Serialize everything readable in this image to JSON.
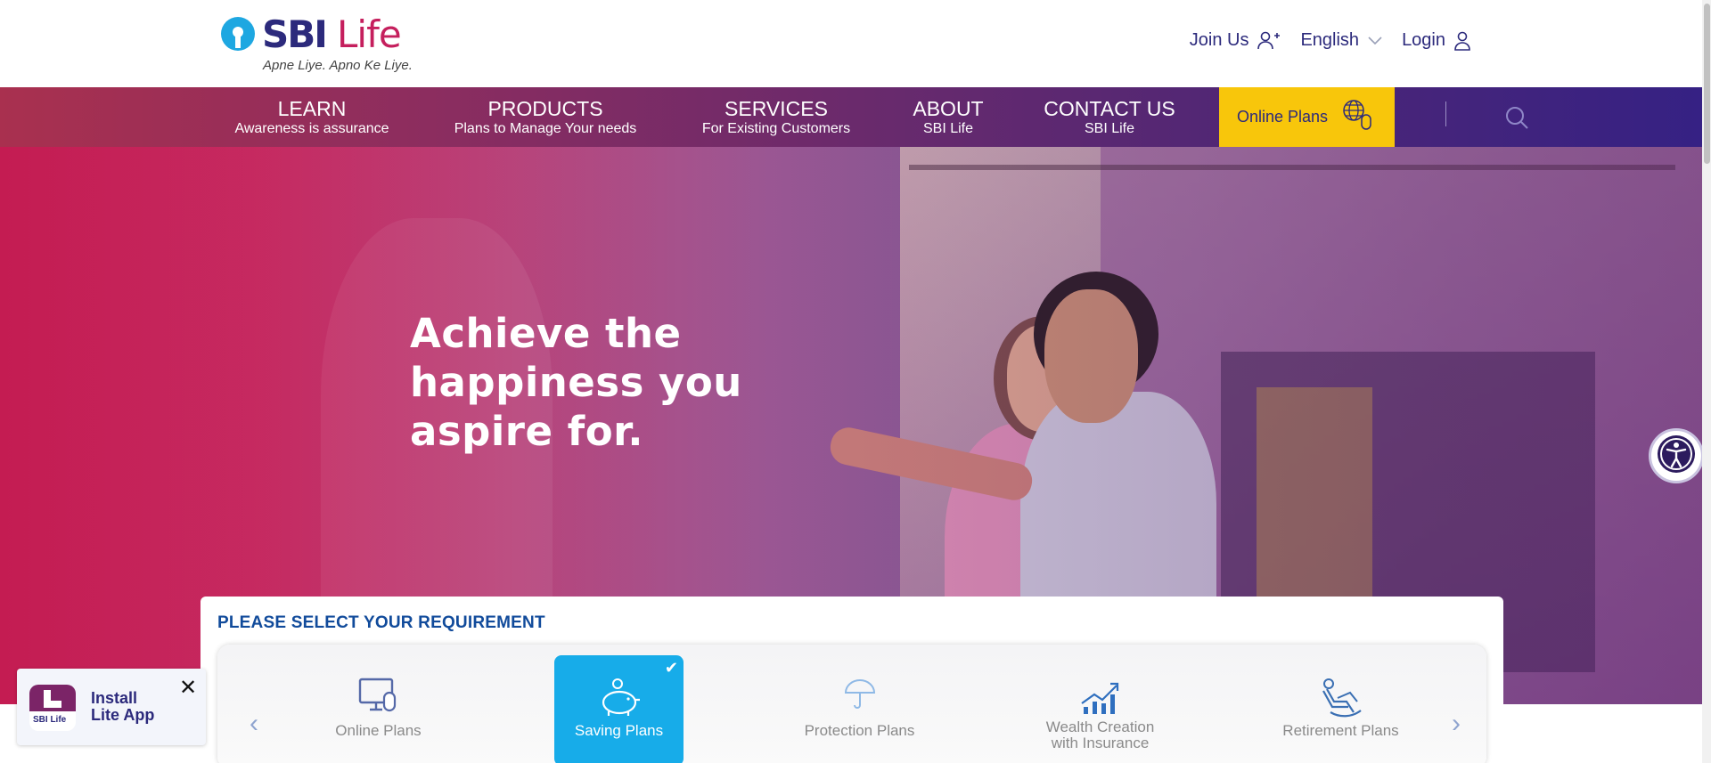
{
  "brand": {
    "name_sbi": "SBI",
    "name_life": "Life",
    "tagline": "Apne Liye. Apno Ke Liye."
  },
  "header": {
    "join_us": "Join Us",
    "language": "English",
    "login": "Login"
  },
  "nav": {
    "items": [
      {
        "title": "LEARN",
        "sub": "Awareness is assurance"
      },
      {
        "title": "PRODUCTS",
        "sub": "Plans to Manage Your needs"
      },
      {
        "title": "SERVICES",
        "sub": "For Existing Customers"
      },
      {
        "title": "ABOUT",
        "sub": "SBI Life"
      },
      {
        "title": "CONTACT US",
        "sub": "SBI Life"
      }
    ],
    "online_plans": "Online Plans"
  },
  "hero": {
    "line1": "Achieve the",
    "line2": "happiness you",
    "line3": "aspire for."
  },
  "requirement": {
    "title": "PLEASE SELECT YOUR REQUIREMENT",
    "plans": [
      {
        "label": "Online Plans",
        "icon": "monitor-icon",
        "selected": false
      },
      {
        "label": "Saving Plans",
        "icon": "piggy-bank-icon",
        "selected": true
      },
      {
        "label": "Protection Plans",
        "icon": "umbrella-icon",
        "selected": false
      },
      {
        "label": "Wealth Creation with Insurance",
        "label_line1": "Wealth Creation",
        "label_line2": "with Insurance",
        "icon": "growth-chart-icon",
        "selected": false
      },
      {
        "label": "Retirement Plans",
        "icon": "recliner-icon",
        "selected": false
      }
    ]
  },
  "install_app": {
    "line1": "Install",
    "line2": "Lite App",
    "logo_text": "SBI Life"
  },
  "colors": {
    "brand_blue": "#2c2a7c",
    "brand_pink": "#c51f5d",
    "online_plans_bg": "#f8c60b",
    "selected_plan": "#17ace9",
    "requirement_title": "#114b9b"
  }
}
